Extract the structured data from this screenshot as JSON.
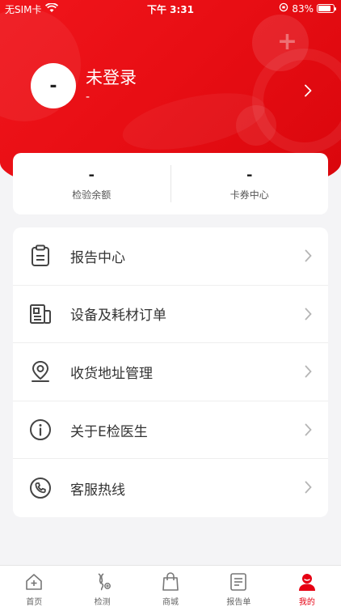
{
  "status_bar": {
    "carrier": "无SIM卡",
    "time": "下午 3:31",
    "battery_percent": "83%",
    "battery_level": 0.83
  },
  "profile": {
    "avatar_text": "-",
    "title": "未登录",
    "subtitle": "-"
  },
  "stats": [
    {
      "value": "-",
      "label": "检验余额"
    },
    {
      "value": "-",
      "label": "卡券中心"
    }
  ],
  "menu": [
    {
      "label": "报告中心",
      "icon": "clipboard-icon"
    },
    {
      "label": "设备及耗材订单",
      "icon": "order-icon"
    },
    {
      "label": "收货地址管理",
      "icon": "location-pin-icon"
    },
    {
      "label": "关于E检医生",
      "icon": "info-icon"
    },
    {
      "label": "客服热线",
      "icon": "phone-icon"
    }
  ],
  "tabbar": {
    "active_color": "#e60012",
    "items": [
      {
        "label": "首页",
        "icon": "home-icon"
      },
      {
        "label": "检测",
        "icon": "test-icon"
      },
      {
        "label": "商城",
        "icon": "shopping-bag-icon"
      },
      {
        "label": "报告单",
        "icon": "report-icon"
      },
      {
        "label": "我的",
        "icon": "user-icon",
        "active": true
      }
    ]
  },
  "colors": {
    "brand_red": "#e80e14",
    "background": "#f4f4f6"
  }
}
